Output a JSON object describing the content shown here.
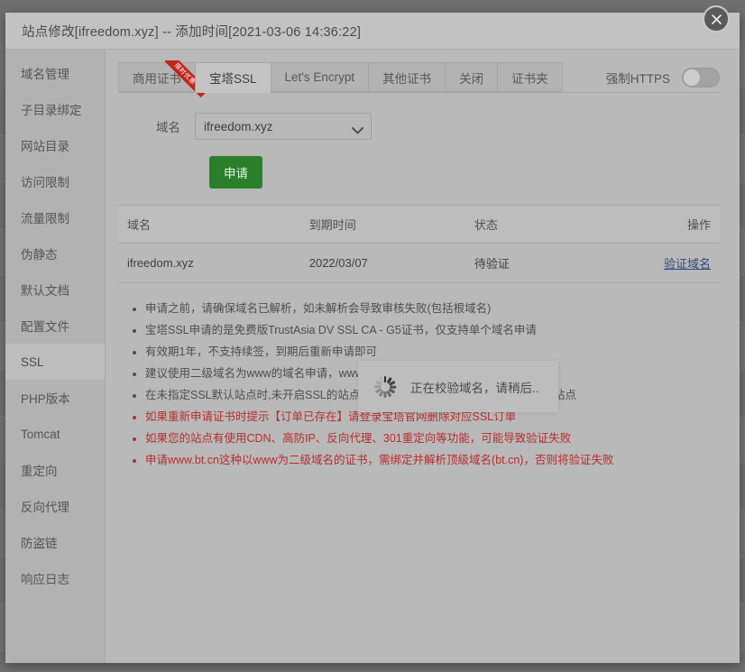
{
  "modal": {
    "title": "站点修改[ifreedom.xyz] -- 添加时间[2021-03-06 14:36:22]",
    "close_icon": "close-icon"
  },
  "sidebar": {
    "items": [
      {
        "label": "域名管理",
        "active": false
      },
      {
        "label": "子目录绑定",
        "active": false
      },
      {
        "label": "网站目录",
        "active": false
      },
      {
        "label": "访问限制",
        "active": false
      },
      {
        "label": "流量限制",
        "active": false
      },
      {
        "label": "伪静态",
        "active": false
      },
      {
        "label": "默认文档",
        "active": false
      },
      {
        "label": "配置文件",
        "active": false
      },
      {
        "label": "SSL",
        "active": true
      },
      {
        "label": "PHP版本",
        "active": false
      },
      {
        "label": "Tomcat",
        "active": false
      },
      {
        "label": "重定向",
        "active": false
      },
      {
        "label": "反向代理",
        "active": false
      },
      {
        "label": "防盗链",
        "active": false
      },
      {
        "label": "响应日志",
        "active": false
      }
    ]
  },
  "tabs": [
    {
      "label": "商用证书",
      "active": false,
      "ribbon": "限时优惠"
    },
    {
      "label": "宝塔SSL",
      "active": true,
      "ribbon": ""
    },
    {
      "label": "Let's Encrypt",
      "active": false,
      "ribbon": ""
    },
    {
      "label": "其他证书",
      "active": false,
      "ribbon": ""
    },
    {
      "label": "关闭",
      "active": false,
      "ribbon": ""
    },
    {
      "label": "证书夹",
      "active": false,
      "ribbon": ""
    }
  ],
  "https": {
    "label": "强制HTTPS",
    "enabled": false
  },
  "form": {
    "domain_label": "域名",
    "domain_value": "ifreedom.xyz",
    "domain_options": [
      "ifreedom.xyz"
    ],
    "apply_label": "申请"
  },
  "table": {
    "headers": [
      "域名",
      "到期时间",
      "状态",
      "操作"
    ],
    "rows": [
      {
        "domain": "ifreedom.xyz",
        "expiry": "2022/03/07",
        "status": "待验证",
        "action": "验证域名"
      }
    ]
  },
  "notes": [
    {
      "text": "申请之前，请确保域名已解析，如未解析会导致审核失败(包括根域名)",
      "warn": false
    },
    {
      "text": "宝塔SSL申请的是免费版TrustAsia DV SSL CA - G5证书，仅支持单个域名申请",
      "warn": false
    },
    {
      "text": "有效期1年，不支持续签，到期后重新申请即可",
      "warn": false
    },
    {
      "text": "建议使用二级域名为www的域名申请，www域名为可选名称",
      "warn": false
    },
    {
      "text": "在未指定SSL默认站点时,未开启SSL的站点使用HTTPS会直接访问到已开启SSL的站点",
      "warn": false
    },
    {
      "text": "如果重新申请证书时提示【订单已存在】请登录宝塔官网删除对应SSL订单",
      "warn": true
    },
    {
      "text": "如果您的站点有使用CDN、高防IP、反向代理、301重定向等功能，可能导致验证失败",
      "warn": true
    },
    {
      "text": "申请www.bt.cn这种以www为二级域名的证书，需绑定并解析顶级域名(bt.cn)，否则将验证失败",
      "warn": true
    }
  ],
  "loading": {
    "text": "正在校验域名，请稍后..",
    "spinner_icon": "spinner-icon"
  },
  "colors": {
    "accent_green": "#2a7f2a",
    "warning_red": "#b82c2c",
    "link_blue": "#2c4a7c",
    "ribbon_red": "#c0261d"
  }
}
